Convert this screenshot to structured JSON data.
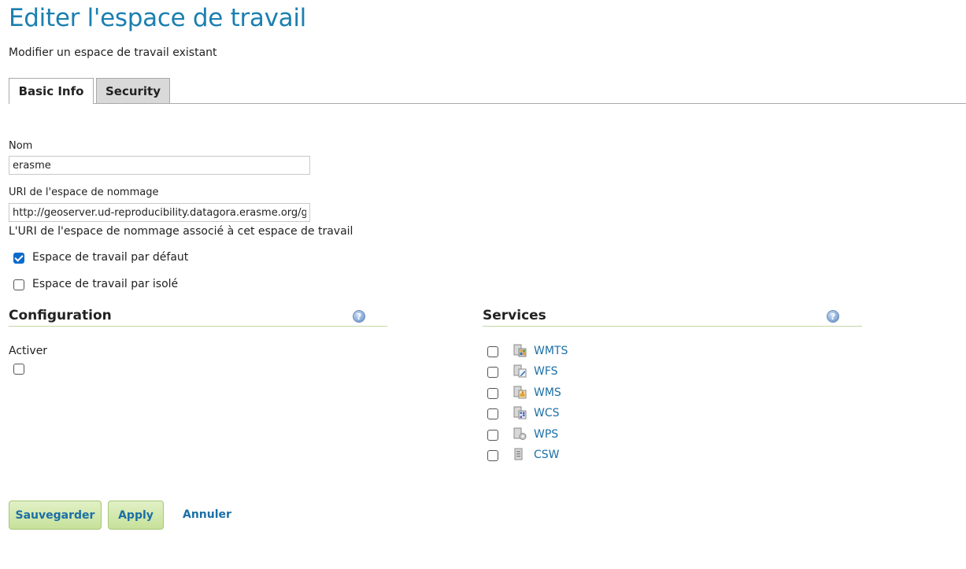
{
  "header": {
    "title": "Editer l'espace de travail",
    "subtitle": "Modifier un espace de travail existant"
  },
  "tabs": [
    {
      "label": "Basic Info",
      "active": true
    },
    {
      "label": "Security",
      "active": false
    }
  ],
  "form": {
    "name_label": "Nom",
    "name_value": "erasme",
    "uri_label": "URI de l'espace de nommage",
    "uri_value": "http://geoserver.ud-reproducibility.datagora.erasme.org/g",
    "uri_help": "L'URI de l'espace de nommage associé à cet espace de travail",
    "default_ws_label": "Espace de travail par défaut",
    "default_ws_checked": true,
    "isolated_ws_label": "Espace de travail par isolé",
    "isolated_ws_checked": false
  },
  "configuration": {
    "title": "Configuration",
    "enable_label": "Activer",
    "enable_checked": false
  },
  "services": {
    "title": "Services",
    "items": [
      {
        "label": "WMTS",
        "checked": false,
        "icon": "wmts-icon"
      },
      {
        "label": "WFS",
        "checked": false,
        "icon": "wfs-icon"
      },
      {
        "label": "WMS",
        "checked": false,
        "icon": "wms-icon"
      },
      {
        "label": "WCS",
        "checked": false,
        "icon": "wcs-icon"
      },
      {
        "label": "WPS",
        "checked": false,
        "icon": "wps-icon"
      },
      {
        "label": "CSW",
        "checked": false,
        "icon": "csw-icon"
      }
    ]
  },
  "actions": {
    "save_label": "Sauvegarder",
    "apply_label": "Apply",
    "cancel_label": "Annuler"
  },
  "colors": {
    "title": "#1b7fb0",
    "link": "#1b6fa6",
    "button_bg": "#c6e19a",
    "checkbox_checked": "#0b6bcb"
  }
}
